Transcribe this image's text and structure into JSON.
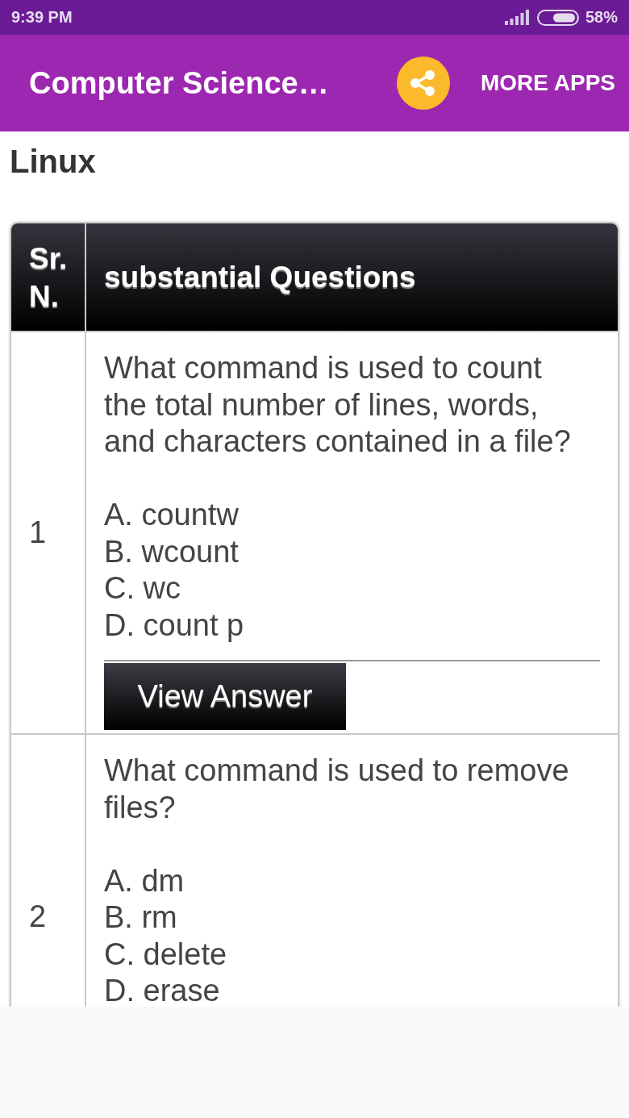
{
  "status_bar": {
    "time": "9:39 PM",
    "battery": "58%"
  },
  "app_bar": {
    "title": "Computer Science…",
    "more_apps": "MORE APPS"
  },
  "page_title": "Linux",
  "table": {
    "columns": [
      "Sr. N.",
      "substantial Questions"
    ],
    "rows": [
      {
        "number": "1",
        "question": "What command is used to count the total number of lines, words, and characters contained in a file?",
        "options": [
          "A. countw",
          "B. wcount",
          "C. wc",
          "D. count p"
        ],
        "button": "View Answer"
      },
      {
        "number": "2",
        "question": "What command is used to remove files?",
        "options": [
          "A. dm",
          "B. rm",
          "C. delete",
          "D. erase"
        ]
      }
    ]
  }
}
